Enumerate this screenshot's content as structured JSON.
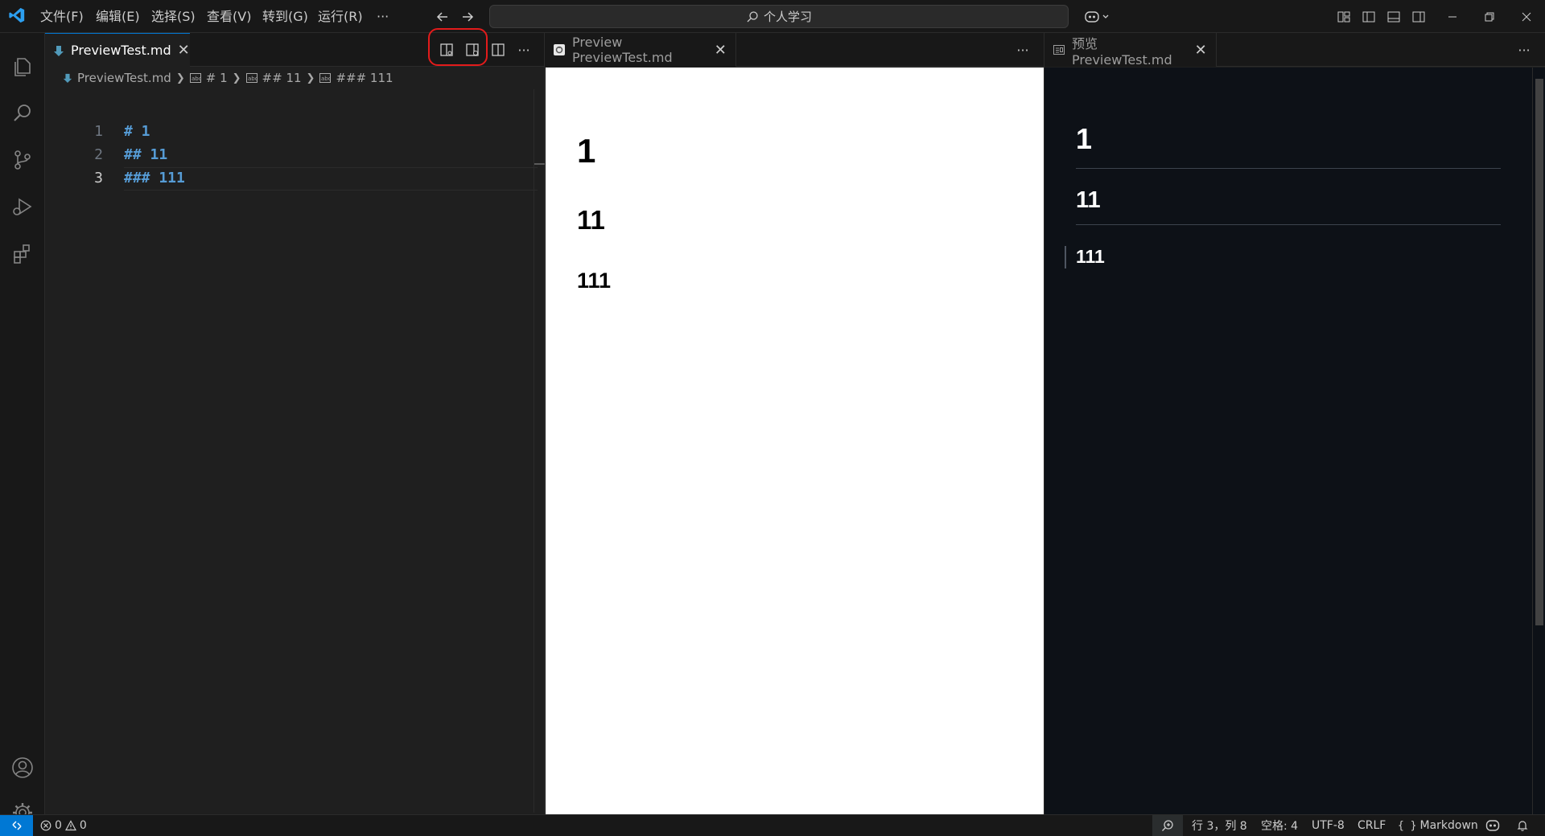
{
  "titlebar": {
    "menus": [
      "文件(F)",
      "编辑(E)",
      "选择(S)",
      "查看(V)",
      "转到(G)",
      "运行(R)",
      "···"
    ],
    "search_text": "个人学习"
  },
  "group1": {
    "tab_label": "PreviewTest.md",
    "breadcrumb": [
      "PreviewTest.md",
      "# 1",
      "## 11",
      "### 111"
    ],
    "lines": [
      {
        "num": "1",
        "text": "# 1"
      },
      {
        "num": "2",
        "text": "## 11"
      },
      {
        "num": "3",
        "text": "### 111"
      }
    ],
    "more": "···"
  },
  "group2": {
    "tab_label": "Preview PreviewTest.md",
    "more": "···",
    "headings": [
      "1",
      "11",
      "111"
    ]
  },
  "group3": {
    "tab_label": "预览 PreviewTest.md",
    "more": "···",
    "headings": [
      "1",
      "11",
      "111"
    ]
  },
  "statusbar": {
    "errors": "0",
    "warnings": "0",
    "position": "行 3，列 8",
    "spaces": "空格: 4",
    "encoding": "UTF-8",
    "eol": "CRLF",
    "language": "Markdown",
    "remote_color": "#0078d4"
  }
}
